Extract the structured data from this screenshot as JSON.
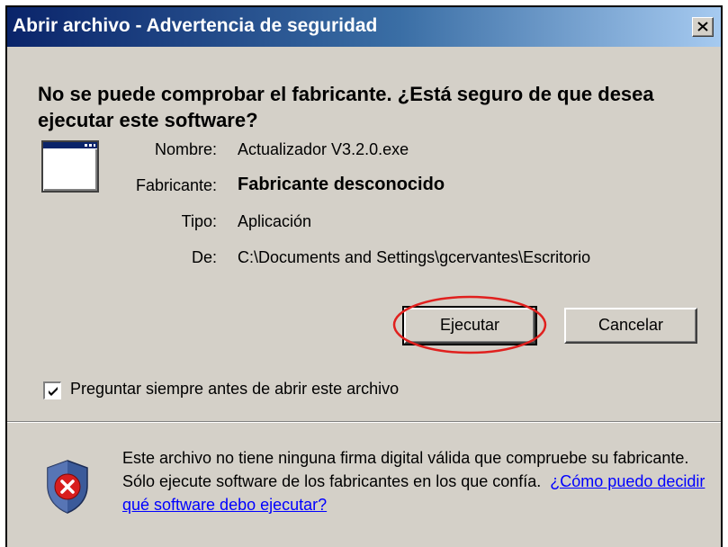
{
  "window": {
    "title": "Abrir archivo - Advertencia de seguridad"
  },
  "heading": "No se puede comprobar el fabricante. ¿Está seguro de que desea ejecutar este software?",
  "fields": {
    "name_label": "Nombre:",
    "name_value": "Actualizador V3.2.0.exe",
    "publisher_label": "Fabricante:",
    "publisher_value": "Fabricante desconocido",
    "type_label": "Tipo:",
    "type_value": "Aplicación",
    "from_label": "De:",
    "from_value": "C:\\Documents and Settings\\gcervantes\\Escritorio"
  },
  "buttons": {
    "run": "Ejecutar",
    "cancel": "Cancelar"
  },
  "checkbox": {
    "label": "Preguntar siempre antes de abrir este archivo",
    "checked": true
  },
  "footer": {
    "text": "Este archivo no tiene ninguna firma digital válida que compruebe su fabricante.  Sólo ejecute software de los fabricantes en los que confía.",
    "link": "¿Cómo puedo decidir qué software debo ejecutar?"
  },
  "icons": {
    "app": "application-window-icon",
    "shield": "security-shield-error-icon",
    "close": "close-icon",
    "check": "checkmark-icon"
  },
  "colors": {
    "title_start": "#0a246a",
    "title_end": "#a6caf0",
    "dialog_bg": "#d4d0c8",
    "annotation": "#e0201e",
    "link": "#0000ff"
  }
}
